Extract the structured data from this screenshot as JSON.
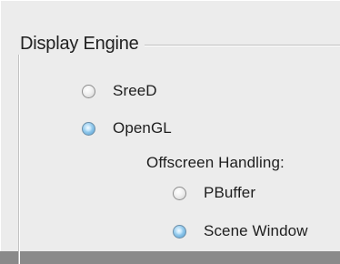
{
  "group": {
    "title": "Display Engine"
  },
  "engine_options": [
    {
      "label": "SreeD",
      "checked": false
    },
    {
      "label": "OpenGL",
      "checked": true
    }
  ],
  "offscreen": {
    "label": "Offscreen Handling:",
    "options": [
      {
        "label": "PBuffer",
        "checked": false
      },
      {
        "label": "Scene Window",
        "checked": true
      }
    ]
  },
  "colors": {
    "panel_background": "#ececec",
    "radio_selected": "#4f9bd0",
    "text": "#1e1e1e"
  }
}
